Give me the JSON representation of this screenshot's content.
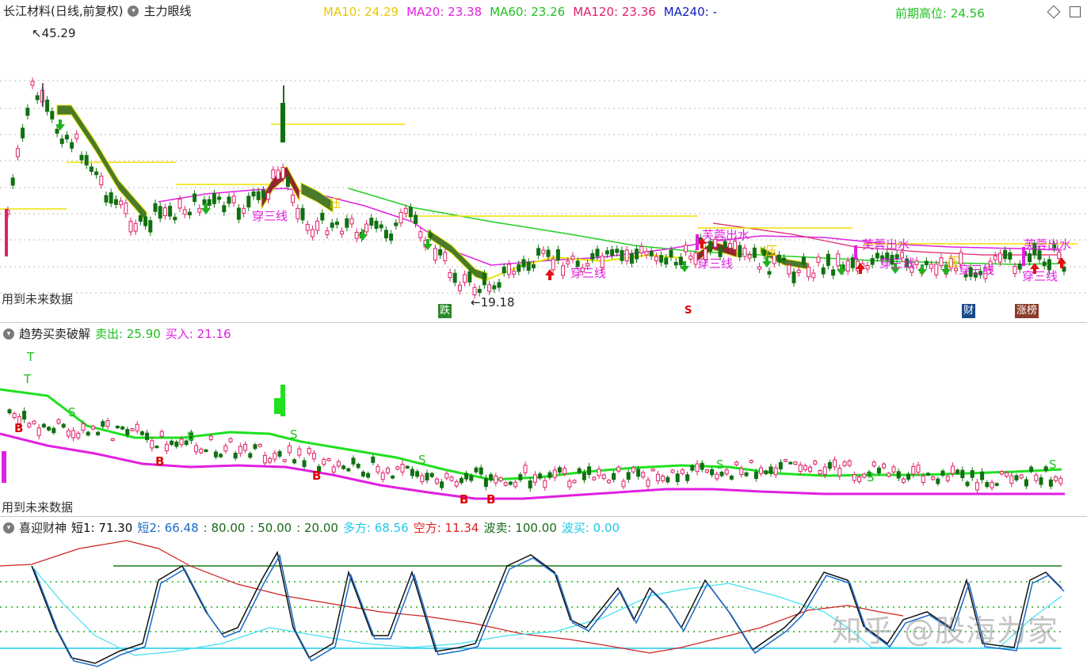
{
  "panel1": {
    "stock_title": "长江材料(日线,前复权)",
    "indicator_name": "主力眼线",
    "ma": [
      {
        "label": "MA10: 24.29",
        "color": "#e6c800"
      },
      {
        "label": "MA20: 23.38",
        "color": "#e020e0"
      },
      {
        "label": "MA60: 23.26",
        "color": "#20c020"
      },
      {
        "label": "MA120: 23.36",
        "color": "#e0206a"
      },
      {
        "label": "MA240: -",
        "color": "#1020c0"
      }
    ],
    "prev_high": "前期高位: 24.56",
    "high_mark": "45.29",
    "low_mark": "19.18",
    "future_data": "用到未来数据",
    "labels": [
      "穿三线",
      "穿三线",
      "穿三线",
      "穿三线",
      "穿三线",
      "芙蓉出水",
      "芙蓉出水",
      "芙蓉出水",
      "压",
      "压",
      "压",
      "穿三线"
    ],
    "tags": [
      {
        "text": "跌",
        "bg": "#2a8a2a"
      },
      {
        "text": "S",
        "bg": "#ffffff",
        "fg": "#d00"
      },
      {
        "text": "财",
        "bg": "#1a4a8a"
      },
      {
        "text": "涨榜",
        "bg": "#8a3a2a"
      }
    ]
  },
  "panel2": {
    "indicator_name": "趋势买卖破解",
    "sell": "卖出: 25.90",
    "buy": "买入: 21.16",
    "future_data": "用到未来数据",
    "letters": [
      "T",
      "T",
      "S",
      "S",
      "S",
      "S",
      "S",
      "S",
      "S",
      "B",
      "B",
      "B",
      "B",
      "B"
    ]
  },
  "panel3": {
    "indicator_name": "喜迎财神",
    "items": [
      {
        "label": "短1: 71.30",
        "color": "#111111"
      },
      {
        "label": "短2: 66.48",
        "color": "#1a6ac8"
      },
      {
        "label": ": 80.00",
        "color": "#1a6a1a"
      },
      {
        "label": ": 50.00",
        "color": "#1a6a1a"
      },
      {
        "label": ": 20.00",
        "color": "#1a6a1a"
      },
      {
        "label": "多方: 68.56",
        "color": "#20c8e8"
      },
      {
        "label": "空方: 11.34",
        "color": "#e02020"
      },
      {
        "label": "波卖: 100.00",
        "color": "#1a6a1a"
      },
      {
        "label": "波买: 0.00",
        "color": "#20c8e8"
      }
    ],
    "watermark": "知乎 @股海为家"
  },
  "colors": {
    "up": "#e0206a",
    "down": "#107010",
    "yellow": "#e6e600",
    "green": "#20c020",
    "magenta": "#e020e0",
    "cyan": "#40e0f0",
    "red": "#e02020",
    "grid": "#b0b0b0"
  }
}
